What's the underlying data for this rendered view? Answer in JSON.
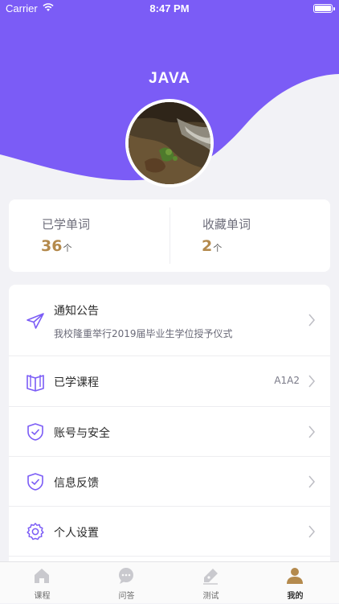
{
  "status_bar": {
    "carrier": "Carrier",
    "time": "8:47 PM"
  },
  "profile": {
    "username": "JAVA"
  },
  "colors": {
    "accent": "#7b5cf6",
    "gold": "#b48a4d",
    "background": "#f2f2f6"
  },
  "stats": [
    {
      "label": "已学单词",
      "value": "36",
      "unit": "个"
    },
    {
      "label": "收藏单词",
      "value": "2",
      "unit": "个"
    }
  ],
  "menu": {
    "notice": {
      "title": "通知公告",
      "subtitle": "我校隆重举行2019届毕业生学位授予仪式",
      "icon": "paper-plane-icon"
    },
    "courses": {
      "title": "已学课程",
      "value": "A1A2",
      "icon": "book-icon"
    },
    "account": {
      "title": "账号与安全",
      "icon": "shield-check-icon"
    },
    "feedback": {
      "title": "信息反馈",
      "icon": "shield-check-icon"
    },
    "settings": {
      "title": "个人设置",
      "icon": "gear-icon"
    }
  },
  "tabs": [
    {
      "label": "课程",
      "icon": "home-icon",
      "active": false
    },
    {
      "label": "问答",
      "icon": "chat-icon",
      "active": false
    },
    {
      "label": "测试",
      "icon": "pen-icon",
      "active": false
    },
    {
      "label": "我的",
      "icon": "person-icon",
      "active": true
    }
  ]
}
